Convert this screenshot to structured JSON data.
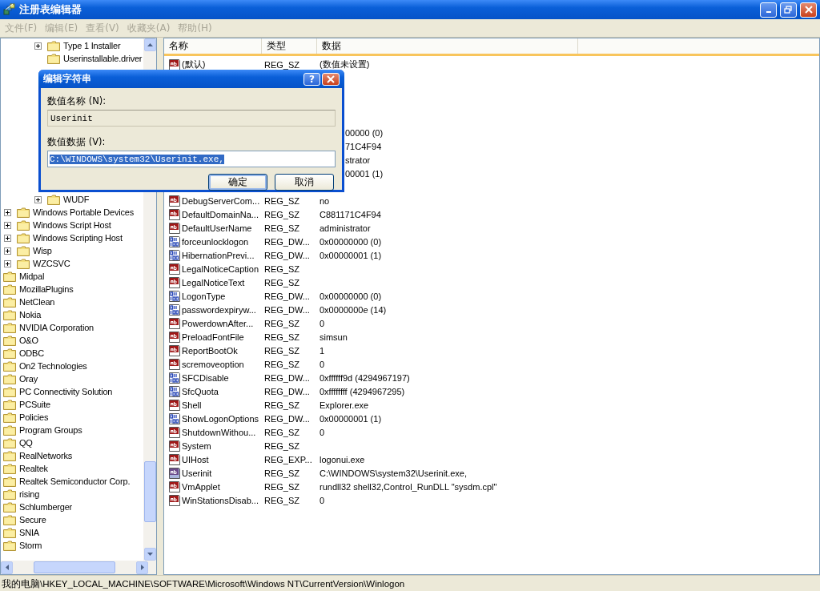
{
  "window": {
    "title": "注册表编辑器"
  },
  "menu": [
    {
      "label": "文件(F)",
      "disabled": true
    },
    {
      "label": "编辑(E)",
      "disabled": true
    },
    {
      "label": "查看(V)",
      "disabled": true
    },
    {
      "label": "收藏夹(A)",
      "disabled": true
    },
    {
      "label": "帮助(H)",
      "disabled": true
    }
  ],
  "tree": [
    {
      "children": [
        {
          "children": [
            {
              "children": [
                {
                  "label": "Type 1 Installer",
                  "expandable": true
                },
                {
                  "label": "Userinstallable.driver",
                  "expandable": false
                },
                {
                  "label": "WUDF",
                  "expandable": true
                }
              ]
            }
          ]
        },
        {
          "label": "Windows Portable Devices",
          "expandable": true
        },
        {
          "label": "Windows Script Host",
          "expandable": true
        },
        {
          "label": "Windows Scripting Host",
          "expandable": true
        },
        {
          "label": "Wisp",
          "expandable": true
        },
        {
          "label": "WZCSVC",
          "expandable": true
        }
      ]
    },
    {
      "label": "Midpal",
      "expandable": false
    },
    {
      "label": "MozillaPlugins",
      "expandable": false
    },
    {
      "label": "NetClean",
      "expandable": false
    },
    {
      "label": "Nokia",
      "expandable": false
    },
    {
      "label": "NVIDIA Corporation",
      "expandable": false
    },
    {
      "label": "O&O",
      "expandable": false
    },
    {
      "label": "ODBC",
      "expandable": false
    },
    {
      "label": "On2 Technologies",
      "expandable": false
    },
    {
      "label": "Oray",
      "expandable": false
    },
    {
      "label": "PC Connectivity Solution",
      "expandable": false
    },
    {
      "label": "PCSuite",
      "expandable": false
    },
    {
      "label": "Policies",
      "expandable": false
    },
    {
      "label": "Program Groups",
      "expandable": false
    },
    {
      "label": "QQ",
      "expandable": false
    },
    {
      "label": "RealNetworks",
      "expandable": false
    },
    {
      "label": "Realtek",
      "expandable": false
    },
    {
      "label": "Realtek Semiconductor Corp.",
      "expandable": false
    },
    {
      "label": "rising",
      "expandable": false
    },
    {
      "label": "Schlumberger",
      "expandable": false
    },
    {
      "label": "Secure",
      "expandable": false
    },
    {
      "label": "SNIA",
      "expandable": false
    },
    {
      "label": "Storm",
      "expandable": false
    }
  ],
  "table": {
    "columns": [
      "名称",
      "类型",
      "数据"
    ],
    "rows": [
      {
        "kind": "string",
        "name": "(默认)",
        "type": "REG_SZ",
        "data": "(数值未设置)",
        "selected": false
      },
      {
        "kind": "covered",
        "data": "00000 (0)"
      },
      {
        "kind": "covered",
        "data": "71C4F94"
      },
      {
        "kind": "covered",
        "data": "strator"
      },
      {
        "kind": "covered",
        "data": "00001 (1)"
      },
      {
        "kind": "string",
        "name": "DebugServerCom...",
        "type": "REG_SZ",
        "data": "no",
        "selected": false
      },
      {
        "kind": "string",
        "name": "DefaultDomainNa...",
        "type": "REG_SZ",
        "data": "C881171C4F94",
        "selected": false
      },
      {
        "kind": "string",
        "name": "DefaultUserName",
        "type": "REG_SZ",
        "data": "administrator",
        "selected": false
      },
      {
        "kind": "binary",
        "name": "forceunlocklogon",
        "type": "REG_DW...",
        "data": "0x00000000 (0)",
        "selected": false
      },
      {
        "kind": "binary",
        "name": "HibernationPrevi...",
        "type": "REG_DW...",
        "data": "0x00000001 (1)",
        "selected": false
      },
      {
        "kind": "string",
        "name": "LegalNoticeCaption",
        "type": "REG_SZ",
        "selected": false
      },
      {
        "kind": "string",
        "name": "LegalNoticeText",
        "type": "REG_SZ",
        "selected": false
      },
      {
        "kind": "binary",
        "name": "LogonType",
        "type": "REG_DW...",
        "data": "0x00000000 (0)",
        "selected": false
      },
      {
        "kind": "binary",
        "name": "passwordexpiryw...",
        "type": "REG_DW...",
        "data": "0x0000000e (14)",
        "selected": false
      },
      {
        "kind": "string",
        "name": "PowerdownAfter...",
        "type": "REG_SZ",
        "data": "0",
        "selected": false
      },
      {
        "kind": "string",
        "name": "PreloadFontFile",
        "type": "REG_SZ",
        "data": "simsun",
        "selected": false
      },
      {
        "kind": "string",
        "name": "ReportBootOk",
        "type": "REG_SZ",
        "data": "1",
        "selected": false
      },
      {
        "kind": "string",
        "name": "scremoveoption",
        "type": "REG_SZ",
        "data": "0",
        "selected": false
      },
      {
        "kind": "binary",
        "name": "SFCDisable",
        "type": "REG_DW...",
        "data": "0xffffff9d (4294967197)",
        "selected": false
      },
      {
        "kind": "binary",
        "name": "SfcQuota",
        "type": "REG_DW...",
        "data": "0xffffffff (4294967295)",
        "selected": false
      },
      {
        "kind": "string",
        "name": "Shell",
        "type": "REG_SZ",
        "data": "Explorer.exe",
        "selected": false
      },
      {
        "kind": "binary",
        "name": "ShowLogonOptions",
        "type": "REG_DW...",
        "data": "0x00000001 (1)",
        "selected": false
      },
      {
        "kind": "string",
        "name": "ShutdownWithou...",
        "type": "REG_SZ",
        "data": "0",
        "selected": false
      },
      {
        "kind": "string",
        "name": "System",
        "type": "REG_SZ",
        "selected": false
      },
      {
        "kind": "string",
        "name": "UIHost",
        "type": "REG_EXP...",
        "data": "logonui.exe",
        "selected": false
      },
      {
        "kind": "string",
        "name": "Userinit",
        "type": "REG_SZ",
        "data": "C:\\WINDOWS\\system32\\Userinit.exe,",
        "selected": true
      },
      {
        "kind": "string",
        "name": "VmApplet",
        "type": "REG_SZ",
        "data": "rundll32 shell32,Control_RunDLL \"sysdm.cpl\"",
        "selected": false
      },
      {
        "kind": "string",
        "name": "WinStationsDisab...",
        "type": "REG_SZ",
        "data": "0",
        "selected": false
      }
    ]
  },
  "dialog": {
    "title": "编辑字符串",
    "help": "?",
    "name_label": "数值名称 (N):",
    "name_value": "Userinit",
    "data_label": "数值数据 (V):",
    "data_value": "C:\\WINDOWS\\system32\\Userinit.exe,",
    "buttons": [
      {
        "label": "确定",
        "default": true
      },
      {
        "label": "取消",
        "default": false
      }
    ]
  },
  "status_bar": "我的电脑\\HKEY_LOCAL_MACHINE\\SOFTWARE\\Microsoft\\Windows NT\\CurrentVersion\\Winlogon"
}
